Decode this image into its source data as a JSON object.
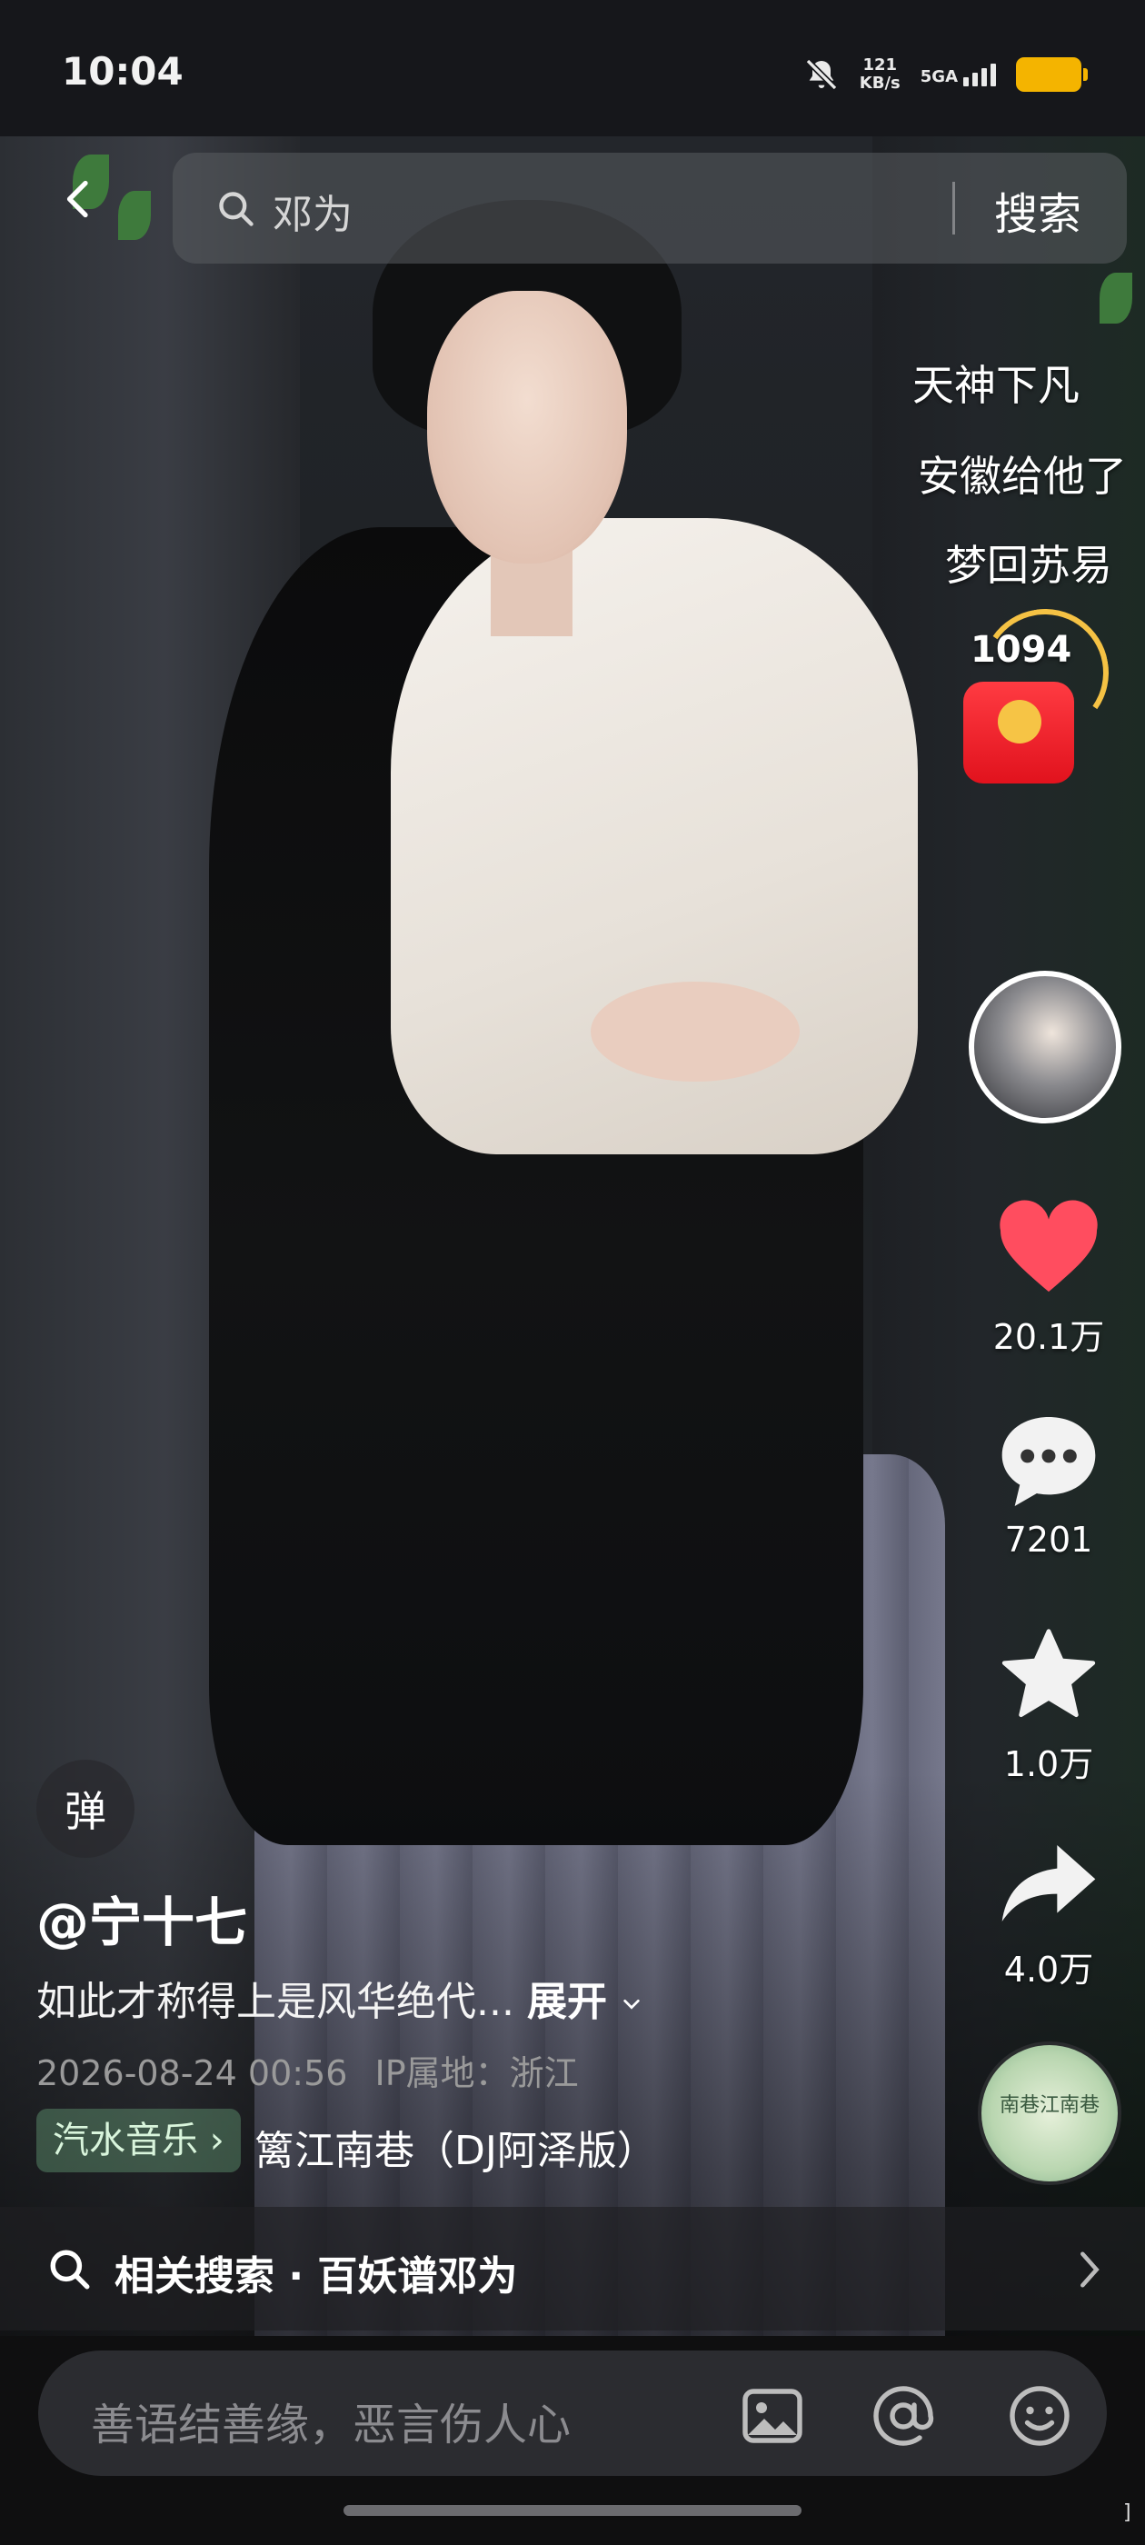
{
  "status": {
    "time": "10:04",
    "speed_value": "121",
    "speed_unit": "KB/s",
    "network": "5GA"
  },
  "search": {
    "query": "邓为",
    "button": "搜索"
  },
  "danmaku": [
    "天神下凡",
    "安徽给他了",
    "梦回苏易"
  ],
  "red_packet": {
    "count": "1094"
  },
  "actions": {
    "likes": "20.1万",
    "comments": "7201",
    "favorites": "1.0万",
    "shares": "4.0万"
  },
  "music_disc_text": "南巷江南巷",
  "caption": {
    "danmaku_toggle": "弹",
    "author": "@宁十七",
    "description": "如此才称得上是风华绝代...",
    "expand": "展开",
    "datetime": "2026-08-24 00:56",
    "ip_location": "IP属地：浙江",
    "music_tag": "汽水音乐",
    "music_title": "篱江南巷（DJ阿泽版）"
  },
  "related": {
    "label": "相关搜索 · 百妖谱邓为"
  },
  "comment": {
    "placeholder": "善语结善缘，恶言伤人心"
  },
  "icons": {
    "back": "chevron-left-icon",
    "search": "search-icon",
    "bell_muted": "bell-off-icon",
    "like": "heart-icon",
    "comment": "chat-bubble-icon",
    "favorite": "star-icon",
    "share": "share-arrow-icon",
    "image": "image-icon",
    "mention": "at-icon",
    "emoji": "emoji-icon"
  },
  "colors": {
    "like": "#ff4d5f",
    "battery": "#f4b400",
    "music_tag_bg": "#4f7a5a"
  }
}
